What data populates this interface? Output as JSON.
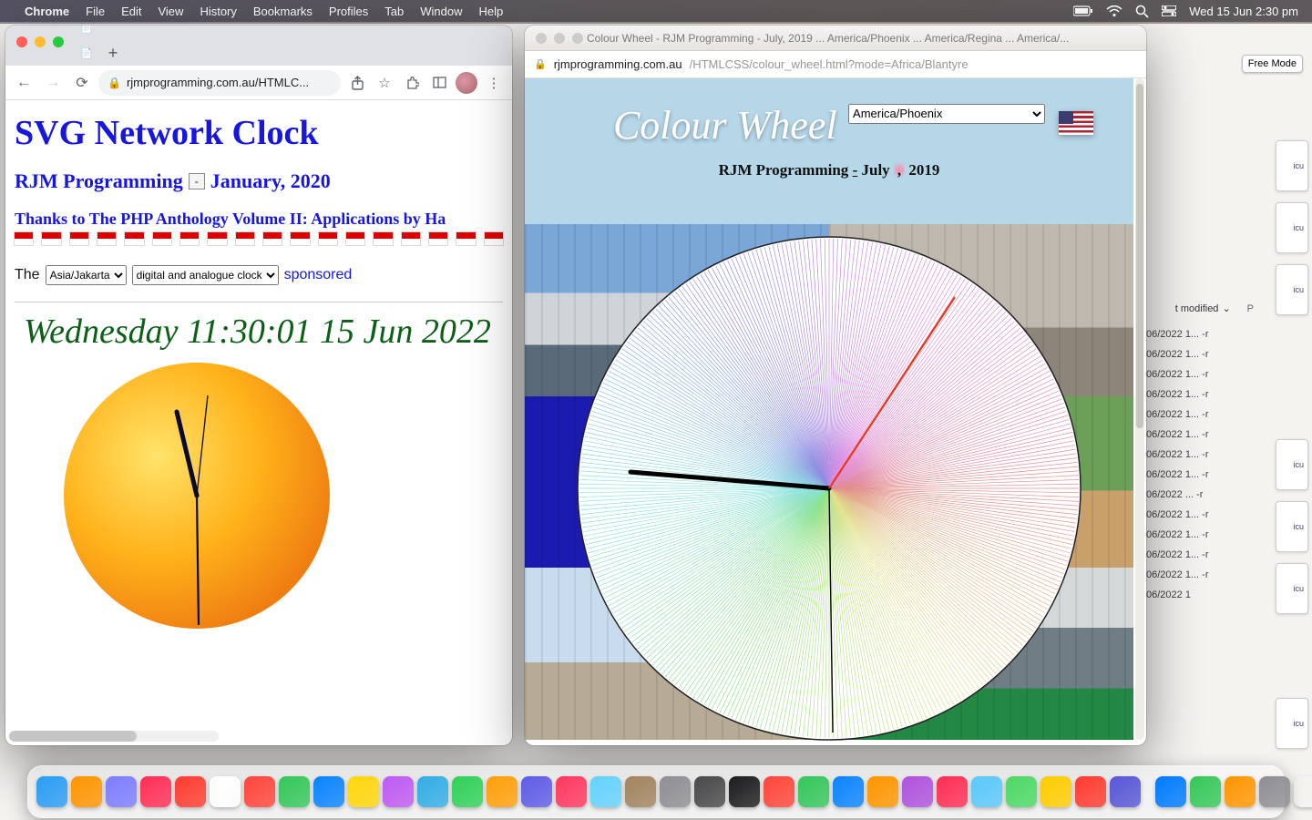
{
  "menubar": {
    "app": "Chrome",
    "items": [
      "File",
      "Edit",
      "View",
      "History",
      "Bookmarks",
      "Profiles",
      "Tab",
      "Window",
      "Help"
    ],
    "clock": "Wed 15 Jun  2:30 pm"
  },
  "bg": {
    "freemode": "Free Mode",
    "sort_header": "t modified",
    "peek_label": "icu",
    "rows": [
      "06/2022 1...   -r",
      "06/2022 1...   -r",
      "06/2022 1...   -r",
      "06/2022 1...   -r",
      "06/2022 1...   -r",
      "06/2022 1...   -r",
      "06/2022 1...   -r",
      "06/2022 1...   -r",
      "06/2022 ...    -r",
      "06/2022 1...   -r",
      "06/2022 1...   -r",
      "06/2022 1...   -r",
      "06/2022 1...   -r",
      "06/2022 1"
    ]
  },
  "chrome": {
    "omnibox": "rjmprogramming.com.au/HTMLC...",
    "page": {
      "title": "SVG Network Clock",
      "byline_left": "RJM Programming",
      "byline_right": "January, 2020",
      "thanks": "Thanks to The PHP Anthology Volume II: Applications by Ha",
      "sentence_pre": "The",
      "tz_select": "Asia/Jakarta",
      "mode_select": "digital and analogue clock",
      "sentence_post": "sponsored",
      "digital": "Wednesday 11:30:01 15 Jun 2022"
    }
  },
  "safari": {
    "title": "Colour Wheel - RJM Programming - July, 2019 ... America/Phoenix ... America/Regina ... America/...",
    "addr_host": "rjmprogramming.com.au",
    "addr_path": "/HTMLCSS/colour_wheel.html?mode=Africa/Blantyre",
    "page": {
      "heading": "Colour Wheel",
      "select": "America/Phoenix",
      "sub_pre": "RJM Programming ",
      "sub_mid_u": "-",
      "sub_mid": " July ",
      "sub_hl": ",",
      "sub_post": " 2019"
    }
  },
  "chart_data": {
    "type": "pie",
    "title": "Colour Wheel",
    "description": "Radial spectrum wheel with two clock-style hands",
    "hands": {
      "hour_angle_deg": 275,
      "second_angle_deg": 35
    }
  }
}
